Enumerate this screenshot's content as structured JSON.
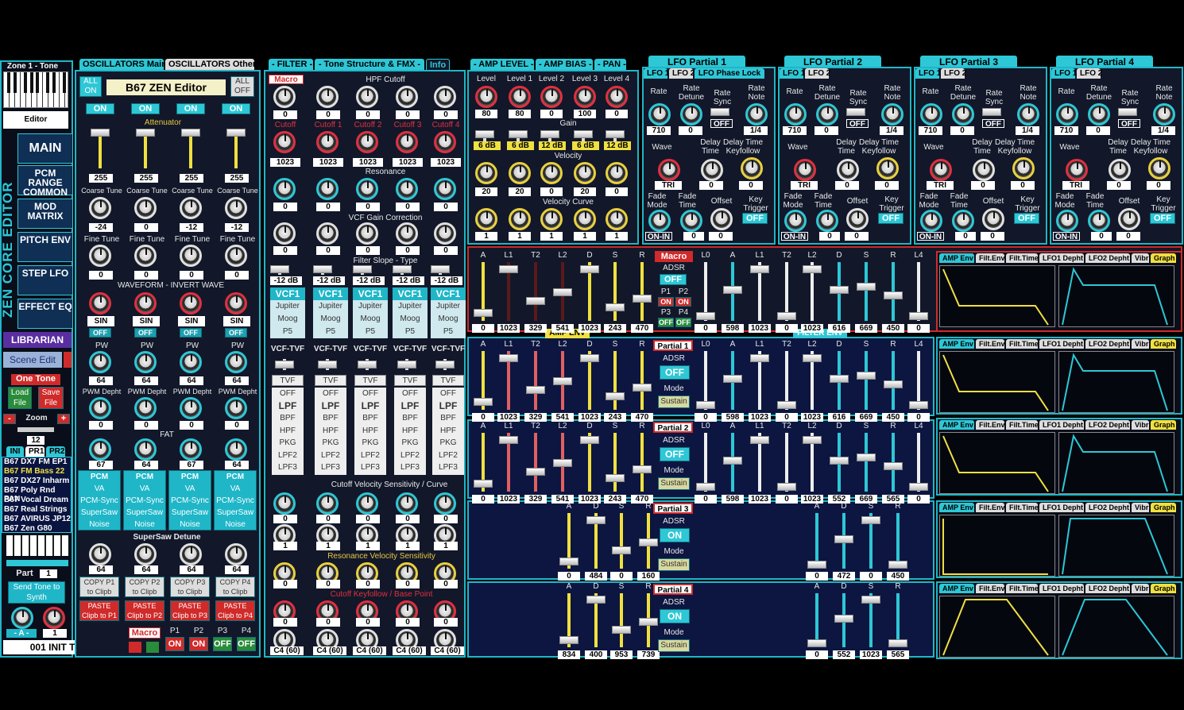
{
  "zone": {
    "title": "Zone 1 - Tone",
    "editor": "Editor",
    "vertical": "ZEN CORE EDITOR"
  },
  "side": {
    "items": [
      "MAIN",
      "PCM RANGE COMMON",
      "MOD MATRIX",
      "PITCH ENV",
      "STEP LFO",
      "EFFECT EQ"
    ],
    "librarian": "LIBRARIAN",
    "scene_edit": "Scene Edit",
    "one_tone": "One Tone",
    "load": "Load File",
    "save": "Save File",
    "zoom": "Zoom",
    "zoom_val": "12",
    "banks": [
      "INI",
      "PR1",
      "PR2"
    ],
    "presets": [
      "B67 DX7 FM EP1",
      "B67 FM Bass 22",
      "B67 DX27 Inharm",
      "B67 Poly Rnd PAN",
      "B67 Vocal Dream",
      "B67 Real Strings",
      "B67 AVIRUS JP12",
      "B67 Zen G80"
    ],
    "part_label": "Part",
    "part_val": "1",
    "send": "Send Tone to Synth",
    "a_label": "- A -",
    "a_val": "1",
    "tone_name": "001 INIT TONE"
  },
  "osc": {
    "tab1": "OSCILLATORS Main",
    "tab2": "OSCILLATORS Other",
    "all_on": "ALL ON",
    "all_off": "ALL OFF",
    "editor_title": "B67 ZEN Editor",
    "on": "ON",
    "attenuator": "Attenuator",
    "att": [
      "255",
      "255",
      "255",
      "255"
    ],
    "coarse_label": "Coarse Tune",
    "coarse": [
      "-24",
      "0",
      "-12",
      "-12"
    ],
    "fine_label": "Fine Tune",
    "fine": [
      "0",
      "0",
      "0",
      "0"
    ],
    "waveform_label": "WAVEFORM - INVERT WAVE",
    "wave": [
      "SIN",
      "SIN",
      "SIN",
      "SIN"
    ],
    "off": "OFF",
    "pw_label": "PW",
    "pw": [
      "64",
      "64",
      "64",
      "64"
    ],
    "pwm_label": "PWM Depht",
    "pwm": [
      "0",
      "0",
      "0",
      "0"
    ],
    "fat_label": "FAT",
    "fat": [
      "67",
      "64",
      "67",
      "64"
    ],
    "types": [
      "PCM",
      "VA",
      "PCM-Sync",
      "SuperSaw",
      "Noise"
    ],
    "ssd_label": "SuperSaw Detune",
    "ssd": [
      "64",
      "64",
      "64",
      "64"
    ],
    "copy": [
      "COPY P1 to Clipb",
      "COPY P2 to Clipb",
      "COPY P3 to Clipb",
      "COPY P4 to Clipb"
    ],
    "paste": [
      "PASTE Clipb to P1",
      "PASTE Clipb to P2",
      "PASTE Clipb to P3",
      "PASTE Clipb to P4"
    ],
    "macro": "Macro",
    "parts": [
      "P1",
      "P2",
      "P3",
      "P4"
    ],
    "part_states": [
      "ON",
      "ON",
      "OFF",
      "OFF"
    ]
  },
  "filter": {
    "tabs": [
      "- FILTER -",
      "- Tone Structure & FMX -",
      "Info"
    ],
    "macro": "Macro",
    "hpf_label": "HPF Cutoff",
    "hpf": [
      "0",
      "0",
      "0",
      "0",
      "0"
    ],
    "cutoff_labels": [
      "Cutoff",
      "Cutoff 1",
      "Cutoff 2",
      "Cutoff 3",
      "Cutoff 4"
    ],
    "cutoff": [
      "1023",
      "1023",
      "1023",
      "1023",
      "1023"
    ],
    "res_label": "Resonance",
    "res": [
      "0",
      "0",
      "0",
      "0",
      "0"
    ],
    "gaincorr_label": "VCF Gain Correction",
    "gc": [
      "0",
      "0",
      "0",
      "0",
      "0"
    ],
    "slope_label": "Filter Slope - Type",
    "slope": [
      "-12 dB",
      "-12 dB",
      "-12 dB",
      "-12 dB",
      "-12 dB"
    ],
    "vcf_types": [
      "VCF1",
      "Jupiter",
      "Moog",
      "P5"
    ],
    "vcftvf": "VCF-TVF",
    "tvf": "TVF",
    "ftypes": [
      "OFF",
      "LPF",
      "BPF",
      "HPF",
      "PKG",
      "LPF2",
      "LPF3"
    ],
    "cvs_label": "Cutoff Velocity Sensitivity / Curve",
    "cvs": [
      "0",
      "0",
      "0",
      "0",
      "0"
    ],
    "curve": [
      "1",
      "1",
      "1",
      "1",
      "1"
    ],
    "rvs_label": "Resonance Velocity Sensitivity",
    "rvs": [
      "0",
      "0",
      "0",
      "0",
      "0"
    ],
    "ckf_label": "Cutoff Keyfollow / Base Point",
    "ckf": [
      "0",
      "0",
      "0",
      "0",
      "0"
    ],
    "bp": [
      "C4 (60)",
      "C4 (60)",
      "C4 (60)",
      "C4 (60)",
      "C4 (60)"
    ]
  },
  "amp": {
    "tabs": [
      "- AMP LEVEL -",
      "- AMP BIAS -",
      "- PAN -"
    ],
    "level_labels": [
      "Level",
      "Level 1",
      "Level 2",
      "Level 3",
      "Level 4"
    ],
    "levels": [
      "80",
      "80",
      "0",
      "100",
      "0"
    ],
    "gain_label": "Gain",
    "gain": [
      "6 dB",
      "6 dB",
      "12 dB",
      "6 dB",
      "12 dB"
    ],
    "vel_label": "Velocity",
    "vel": [
      "20",
      "20",
      "0",
      "20",
      "0"
    ],
    "curve_label": "Velocity Curve",
    "curve": [
      "1",
      "1",
      "1",
      "1",
      "1"
    ]
  },
  "lfo": {
    "titles": [
      "LFO Partial 1",
      "LFO Partial 2",
      "LFO Partial 3",
      "LFO Partial 4"
    ],
    "tab1": "LFO 1",
    "tab2": "LFO 2",
    "phase": "LFO Phase Lock",
    "rate": "Rate",
    "detune": "Rate Detune",
    "sync": "Rate Sync",
    "note": "Rate Note",
    "rate_v": "710",
    "detune_v": "0",
    "sync_v": "OFF",
    "note_v": "1/4",
    "wave": "Wave",
    "delay": "Delay Time",
    "dkf": "Delay Time Keyfollow",
    "wave_v": "TRI",
    "delay_v": "0",
    "dkf_v": "0",
    "fmode": "Fade Mode",
    "ftime": "Fade Time",
    "offset": "Offset",
    "key": "Key Trigger",
    "fmode_v": "ON-IN",
    "ftime_v": "0",
    "offset_v": "0",
    "key_v": "OFF"
  },
  "env": {
    "amp_labels": [
      "A",
      "L1",
      "T2",
      "L2",
      "D",
      "S",
      "R"
    ],
    "filt_labels": [
      "L0",
      "A",
      "L1",
      "T2",
      "L2",
      "D",
      "S",
      "R",
      "L4"
    ],
    "macro_amp": [
      "0",
      "1023",
      "329",
      "541",
      "1023",
      "243",
      "470"
    ],
    "macro_filt": [
      "0",
      "598",
      "1023",
      "0",
      "1023",
      "616",
      "669",
      "450",
      "0"
    ],
    "p1_amp": [
      "0",
      "1023",
      "329",
      "541",
      "1023",
      "243",
      "470"
    ],
    "p1_filt": [
      "0",
      "598",
      "1023",
      "0",
      "1023",
      "616",
      "669",
      "450",
      "0"
    ],
    "p2_amp": [
      "0",
      "1023",
      "329",
      "541",
      "1023",
      "243",
      "470"
    ],
    "p2_filt": [
      "0",
      "598",
      "1023",
      "0",
      "1023",
      "552",
      "669",
      "565",
      "0"
    ],
    "p3_amp_labels": [
      "A",
      "D",
      "S",
      "R"
    ],
    "p3_amp": [
      "0",
      "484",
      "0",
      "160"
    ],
    "p3_filt": [
      "0",
      "472",
      "0",
      "450"
    ],
    "p4_amp": [
      "834",
      "400",
      "953",
      "739"
    ],
    "p4_filt": [
      "0",
      "552",
      "1023",
      "565"
    ],
    "amp_env": "AMP ENV",
    "filter_env": "FILTER ENV",
    "macro": "Macro",
    "adsr": "ADSR",
    "off": "OFF",
    "on": "ON",
    "mode": "Mode",
    "sustain": "Sustain",
    "p_labels": [
      "P1",
      "P2",
      "P3",
      "P4"
    ],
    "p_states": [
      "ON",
      "ON",
      "OFF",
      "OFF"
    ],
    "partials": [
      "Partial 1",
      "Partial 2",
      "Partial 3",
      "Partial 4"
    ]
  },
  "graph": {
    "tabs": [
      "AMP Env",
      "Filt.Env",
      "Filt.Time",
      "LFO1 Depht",
      "LFO2 Depht",
      "Vibr",
      "Graph"
    ]
  }
}
